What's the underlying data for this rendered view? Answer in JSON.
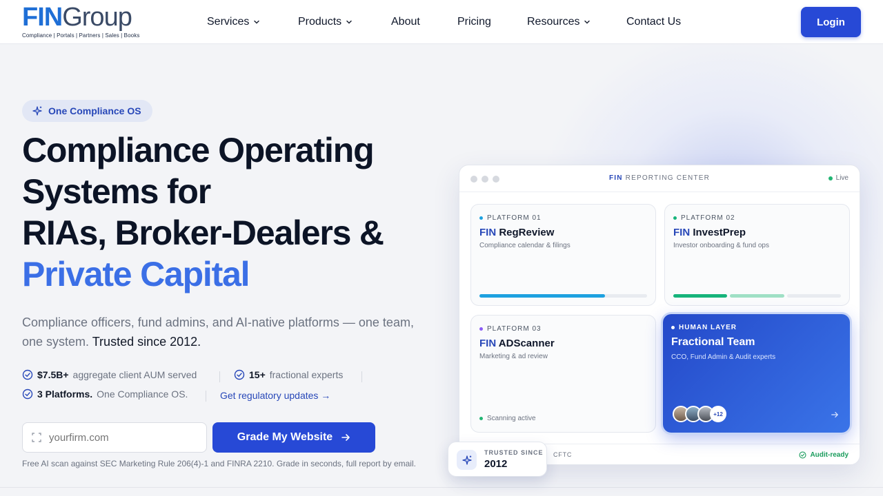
{
  "header": {
    "logo_fin": "FIN",
    "logo_group": "Group",
    "logo_tagline": "Compliance | Portals | Partners | Sales | Books",
    "nav": [
      {
        "label": "Services",
        "dropdown": true
      },
      {
        "label": "Products",
        "dropdown": true
      },
      {
        "label": "About",
        "dropdown": false
      },
      {
        "label": "Pricing",
        "dropdown": false
      },
      {
        "label": "Resources",
        "dropdown": true
      },
      {
        "label": "Contact Us",
        "dropdown": false
      }
    ],
    "login_label": "Login"
  },
  "hero": {
    "badge": "One Compliance OS",
    "title_lines": [
      "Compliance Operating",
      "Systems for",
      "RIAs, Broker-Dealers &"
    ],
    "title_accent": "Private Capital",
    "subtitle": "Compliance officers, fund admins, and AI-native platforms — one team, one system.",
    "subtitle_strong": "Trusted since 2012.",
    "stats": [
      {
        "strong": "$7.5B+",
        "text": "aggregate client AUM served"
      },
      {
        "strong": "15+",
        "text": "fractional experts"
      },
      {
        "strong": "3 Platforms.",
        "text": "One Compliance OS."
      }
    ],
    "updates_link": "Get regulatory updates →",
    "input_placeholder": "yourfirm.com",
    "grade_button": "Grade My Website",
    "fine_print": "Free AI scan against SEC Marketing Rule 206(4)-1 and FINRA 2210. Grade in seconds, full report by email."
  },
  "dashboard": {
    "title_strong": "FIN",
    "title": "REPORTING CENTER",
    "status": "Live",
    "platforms": [
      {
        "tag": "PLATFORM 01",
        "prefix": "FIN",
        "name": "RegReview",
        "desc": "Compliance calendar & filings",
        "progress": 0.75
      },
      {
        "tag": "PLATFORM 02",
        "prefix": "FIN",
        "name": "InvestPrep",
        "desc": "Investor onboarding & fund ops",
        "steps_done": 2,
        "steps_total": 3
      },
      {
        "tag": "PLATFORM 03",
        "prefix": "FIN",
        "name": "ADScanner",
        "desc": "Marketing & ad review",
        "status": "Scanning active"
      }
    ],
    "team": {
      "tag": "HUMAN LAYER",
      "name": "Fractional Team",
      "desc": "CCO, Fund Admin & Audit experts",
      "more_count": "+12"
    },
    "footer_left": "CFTC",
    "footer_right": "Audit-ready",
    "trusted_label": "TRUSTED SINCE",
    "trusted_year": "2012"
  },
  "colors": {
    "primary": "#2749d6",
    "accent_text": "#3b6fe6",
    "platform1_dot": "#1da1e0",
    "platform2_dot": "#16b47b",
    "platform3_dot": "#8b5cf6",
    "success": "#22b573"
  },
  "icons": {
    "badge": "sparkle-icon",
    "check": "check-circle-icon",
    "input": "scan-frame-icon",
    "button_arrow": "arrow-right-icon"
  }
}
